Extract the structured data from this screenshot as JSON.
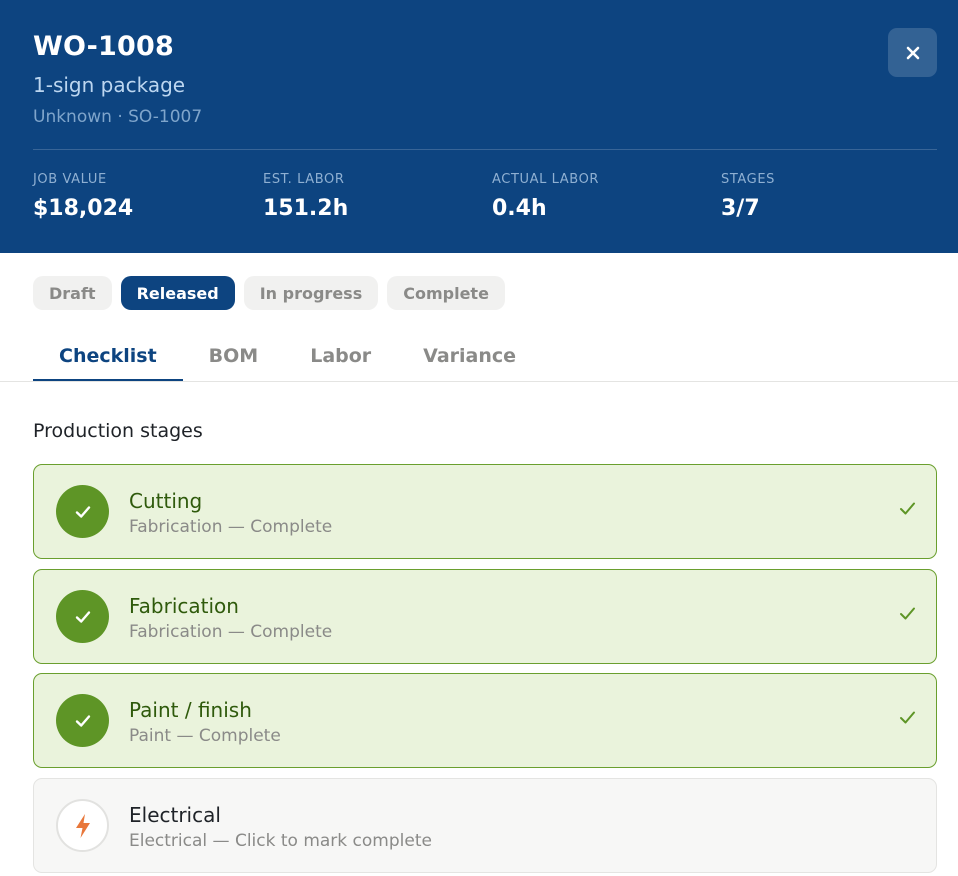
{
  "header": {
    "wo_number": "WO-1008",
    "title": "1-sign package",
    "subtitle": "Unknown · SO-1007",
    "close_icon": "close-icon",
    "stats": [
      {
        "label": "JOB VALUE",
        "value": "$18,024"
      },
      {
        "label": "EST. LABOR",
        "value": "151.2h"
      },
      {
        "label": "ACTUAL LABOR",
        "value": "0.4h"
      },
      {
        "label": "STAGES",
        "value": "3/7"
      }
    ]
  },
  "status_pills": [
    {
      "label": "Draft",
      "active": false
    },
    {
      "label": "Released",
      "active": true
    },
    {
      "label": "In progress",
      "active": false
    },
    {
      "label": "Complete",
      "active": false
    }
  ],
  "tabs": [
    {
      "label": "Checklist",
      "active": true
    },
    {
      "label": "BOM",
      "active": false
    },
    {
      "label": "Labor",
      "active": false
    },
    {
      "label": "Variance",
      "active": false
    }
  ],
  "section_title": "Production stages",
  "stages": [
    {
      "name": "Cutting",
      "desc": "Fabrication — Complete",
      "complete": true,
      "icon": "check-icon"
    },
    {
      "name": "Fabrication",
      "desc": "Fabrication — Complete",
      "complete": true,
      "icon": "check-icon"
    },
    {
      "name": "Paint / finish",
      "desc": "Paint — Complete",
      "complete": true,
      "icon": "check-icon"
    },
    {
      "name": "Electrical",
      "desc": "Electrical — Click to mark complete",
      "complete": false,
      "icon": "lightning-icon"
    }
  ],
  "colors": {
    "header_bg": "#0d4480",
    "complete_green": "#5e9526",
    "complete_bg": "#eaf3dc",
    "lightning_orange": "#e8773a"
  }
}
